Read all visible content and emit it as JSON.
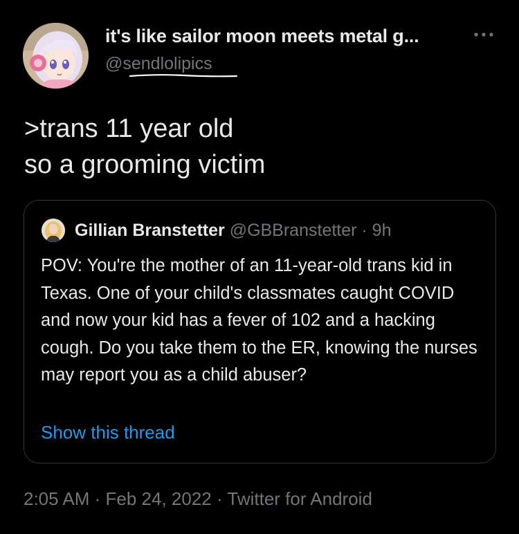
{
  "author": {
    "display_name": "it's like sailor moon meets metal g...",
    "handle": "@sendlolipics",
    "avatar_icon": "anime-girl-avatar"
  },
  "menu": {
    "icon": "more-horizontal-icon"
  },
  "tweet": {
    "text": ">trans 11 year old\nso a grooming victim"
  },
  "quoted": {
    "name": "Gillian Branstetter",
    "meta": "@GBBranstetter · 9h",
    "text": "POV: You're the mother of an 11-year-old trans kid in Texas. One of your child's classmates caught COVID and now your kid has a fever of 102 and a hacking cough. Do you take them to the ER, knowing the nurses may report you as a child abuser?",
    "link": "Show this thread",
    "avatar_icon": "profile-photo-avatar"
  },
  "footer": {
    "timestamp": "2:05 AM · Feb 24, 2022 · Twitter for Android"
  },
  "colors": {
    "background": "#000000",
    "text": "#e7e9ea",
    "muted": "#71767b",
    "link": "#1d9bf0",
    "border": "#333639"
  }
}
